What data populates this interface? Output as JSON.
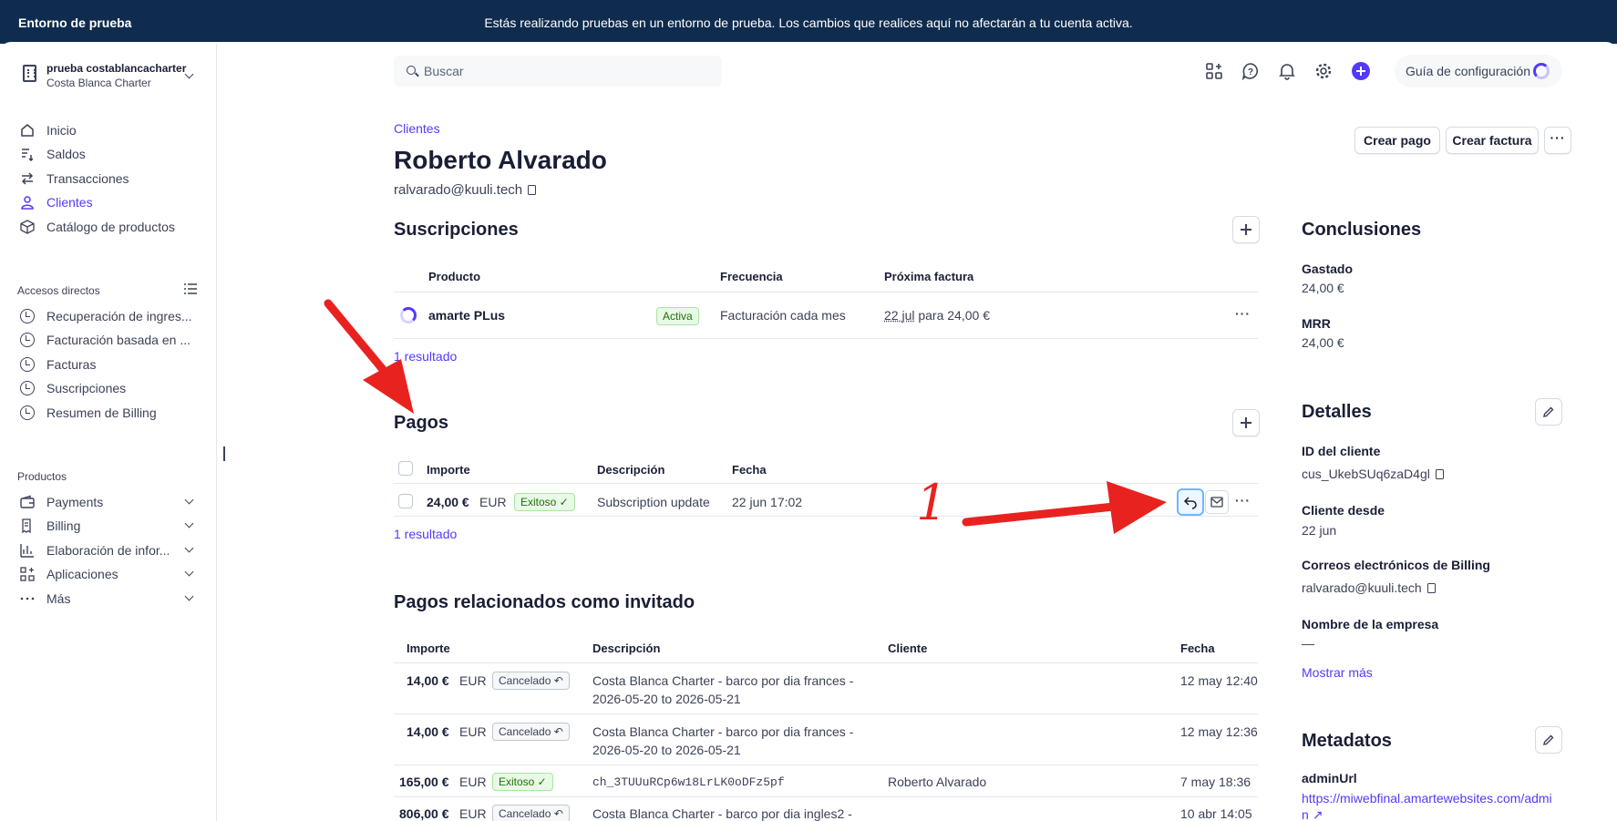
{
  "banner": {
    "env_label": "Entorno de prueba",
    "message": "Estás realizando pruebas en un entorno de prueba. Los cambios que realices aquí no afectarán a tu cuenta activa."
  },
  "account": {
    "name": "prueba costablancacharter",
    "sub": "Costa Blanca Charter"
  },
  "sidebar": {
    "main": [
      {
        "label": "Inicio",
        "icon": "home-icon"
      },
      {
        "label": "Saldos",
        "icon": "balance-icon"
      },
      {
        "label": "Transacciones",
        "icon": "arrows-icon"
      },
      {
        "label": "Clientes",
        "icon": "person-icon",
        "active": true
      },
      {
        "label": "Catálogo de productos",
        "icon": "box-icon"
      }
    ],
    "shortcuts_title": "Accesos directos",
    "shortcuts": [
      {
        "label": "Recuperación de ingres..."
      },
      {
        "label": "Facturación basada en ..."
      },
      {
        "label": "Facturas"
      },
      {
        "label": "Suscripciones"
      },
      {
        "label": "Resumen de Billing"
      }
    ],
    "products_title": "Productos",
    "products": [
      {
        "label": "Payments",
        "icon": "wallet-icon"
      },
      {
        "label": "Billing",
        "icon": "billing-icon"
      },
      {
        "label": "Elaboración de infor...",
        "icon": "bar-chart-icon"
      },
      {
        "label": "Aplicaciones",
        "icon": "apps-icon"
      },
      {
        "label": "Más",
        "icon": "more-icon"
      }
    ]
  },
  "search": {
    "placeholder": "Buscar"
  },
  "setup_guide": {
    "label": "Guía de configuración"
  },
  "customer": {
    "breadcrumb": "Clientes",
    "name": "Roberto Alvarado",
    "email": "ralvarado@kuuli.tech"
  },
  "actions": {
    "create_payment": "Crear pago",
    "create_invoice": "Crear factura",
    "more": "···"
  },
  "subscriptions": {
    "title": "Suscripciones",
    "headers": {
      "product": "Producto",
      "frequency": "Frecuencia",
      "next_invoice": "Próxima factura"
    },
    "row": {
      "product": "amarte PLus",
      "status": "Activa",
      "frequency": "Facturación cada mes",
      "next_date": "22 jul",
      "next_rest": "para 24,00 €"
    },
    "count": "1 resultado"
  },
  "payments": {
    "title": "Pagos",
    "headers": {
      "amount": "Importe",
      "description": "Descripción",
      "date": "Fecha"
    },
    "row": {
      "amount": "24,00 €",
      "currency": "EUR",
      "status": "Exitoso ✓",
      "description": "Subscription update",
      "date": "22 jun 17:02"
    },
    "count": "1 resultado"
  },
  "related": {
    "title": "Pagos relacionados como invitado",
    "headers": {
      "amount": "Importe",
      "description": "Descripción",
      "customer": "Cliente",
      "date": "Fecha"
    },
    "rows": [
      {
        "amount": "14,00 €",
        "currency": "EUR",
        "status": "Cancelado ↶",
        "desc1": "Costa Blanca Charter - barco por dia frances -",
        "desc2": "2026-05-20 to 2026-05-21",
        "customer": "",
        "date": "12 may 12:40"
      },
      {
        "amount": "14,00 €",
        "currency": "EUR",
        "status": "Cancelado ↶",
        "desc1": "Costa Blanca Charter - barco por dia frances -",
        "desc2": "2026-05-20 to 2026-05-21",
        "customer": "",
        "date": "12 may 12:36"
      },
      {
        "amount": "165,00 €",
        "currency": "EUR",
        "status": "Exitoso ✓",
        "desc1": "ch_3TUUuRCp6w18LrLK0oDFz5pf",
        "desc2": "",
        "customer": "Roberto Alvarado",
        "date": "7 may 18:36"
      },
      {
        "amount": "806,00 €",
        "currency": "EUR",
        "status": "Cancelado ↶",
        "desc1": "Costa Blanca Charter - barco por dia ingles2 -",
        "desc2": "",
        "customer": "",
        "date": "10 abr 14:05"
      }
    ]
  },
  "insights": {
    "title": "Conclusiones",
    "spent_label": "Gastado",
    "spent_value": "24,00 €",
    "mrr_label": "MRR",
    "mrr_value": "24,00 €"
  },
  "details": {
    "title": "Detalles",
    "id_label": "ID del cliente",
    "id_value": "cus_UkebSUq6zaD4gl",
    "since_label": "Cliente desde",
    "since_value": "22 jun",
    "billing_emails_label": "Correos electrónicos de Billing",
    "billing_emails_value": "ralvarado@kuuli.tech",
    "company_label": "Nombre de la empresa",
    "company_value": "—",
    "show_more": "Mostrar más"
  },
  "metadata": {
    "title": "Metadatos",
    "key": "adminUrl",
    "value1": "https://miwebfinal.amartewebsites.com/admi",
    "value2": "n"
  },
  "annotation": {
    "number": "1"
  },
  "colors": {
    "accent": "#533afd",
    "banner": "#0f2c4e",
    "arrow": "#e8231f"
  }
}
